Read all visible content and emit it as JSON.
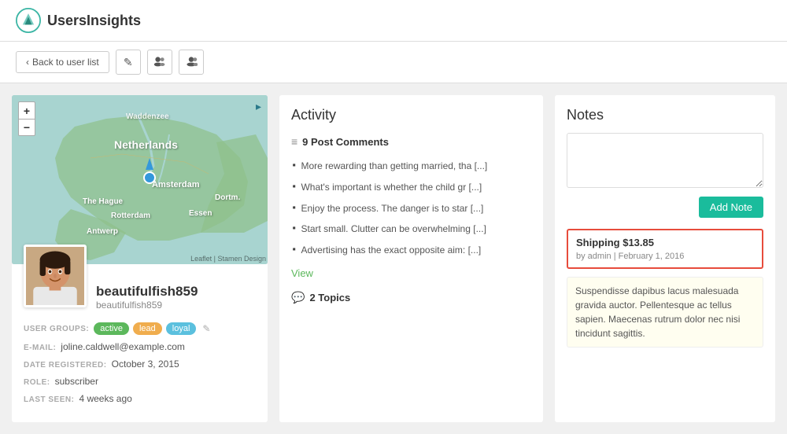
{
  "header": {
    "logo_text": "UsersInsights"
  },
  "toolbar": {
    "back_label": "Back to user list",
    "edit_icon": "✎",
    "group_icon": "👥",
    "users_icon": "👤"
  },
  "map": {
    "zoom_in": "+",
    "zoom_out": "−",
    "labels": [
      "Waddenzee",
      "Netherlands",
      "Amsterdam",
      "The Hague",
      "Rotterdam",
      "Antwerp",
      "Essen",
      "Dortm."
    ],
    "attribution": "Leaflet | Stamen Design"
  },
  "user": {
    "display_name": "beautifulfish859",
    "username": "beautifulfish859",
    "groups": [
      "active",
      "lead",
      "loyal"
    ],
    "groups_labels": {
      "active": "active",
      "lead": "lead",
      "loyal": "loyal"
    },
    "email": "joline.caldwell@example.com",
    "date_registered": "October 3, 2015",
    "role": "subscriber",
    "last_seen": "4 weeks ago",
    "meta_labels": {
      "user_groups": "USER GROUPS:",
      "email": "E-MAIL:",
      "date_registered": "DATE REGISTERED:",
      "role": "ROLE:",
      "last_seen": "LAST SEEN:"
    }
  },
  "activity": {
    "title": "Activity",
    "post_comments_count": "9 Post Comments",
    "comments": [
      "More rewarding than getting married, tha [...]",
      "What's important is whether the child gr [...]",
      "Enjoy the process. The danger is to star [...]",
      "Start small. Clutter can be overwhelming [...]",
      "Advertising has the exact opposite aim: [...]"
    ],
    "view_label": "View",
    "topics_count": "2 Topics"
  },
  "notes": {
    "title": "Notes",
    "textarea_placeholder": "",
    "add_note_label": "Add Note",
    "highlighted_note": {
      "title": "Shipping $13.85",
      "meta": "by admin | February 1, 2016"
    },
    "plain_note": {
      "body": "Suspendisse dapibus lacus malesuada gravida auctor. Pellentesque ac tellus sapien. Maecenas rutrum dolor nec nisi tincidunt sagittis."
    }
  }
}
